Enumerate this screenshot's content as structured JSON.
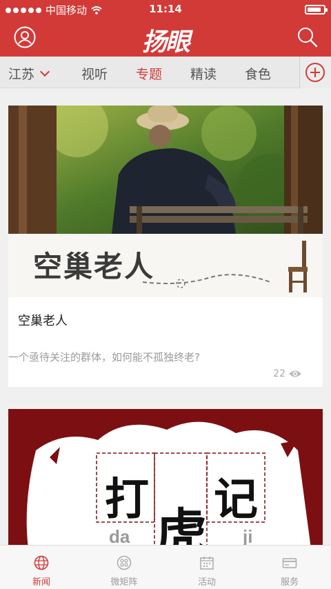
{
  "status_bar": {
    "carrier": "中国移动",
    "time": "11:14",
    "signal_bars": 5,
    "battery_level": 0.85
  },
  "header": {
    "logo_text": "扬眼",
    "user_icon": "user-icon",
    "search_icon": "search-icon"
  },
  "tabs": [
    {
      "label": "江苏",
      "active": false,
      "dropdown": true
    },
    {
      "label": "视听",
      "active": false
    },
    {
      "label": "专题",
      "active": true
    },
    {
      "label": "精读",
      "active": false
    },
    {
      "label": "食色",
      "active": false
    }
  ],
  "add_icon": "plus-circle-icon",
  "feed": [
    {
      "banner_text": "空巢老人",
      "title": "空巢老人",
      "description": "一个亟待关注的群体，如何能不孤独终老?",
      "views": "22"
    },
    {
      "banner_chars": [
        "打",
        "虎",
        "记"
      ],
      "pinyin": [
        "da",
        "ji"
      ]
    }
  ],
  "bottom_nav": [
    {
      "label": "新闻",
      "icon": "globe-icon",
      "active": true
    },
    {
      "label": "微矩阵",
      "icon": "matrix-icon",
      "active": false
    },
    {
      "label": "活动",
      "icon": "calendar-icon",
      "active": false
    },
    {
      "label": "服务",
      "icon": "card-icon",
      "active": false
    }
  ],
  "colors": {
    "brand_red": "#d23a38",
    "dark_red": "#7c0f12"
  }
}
